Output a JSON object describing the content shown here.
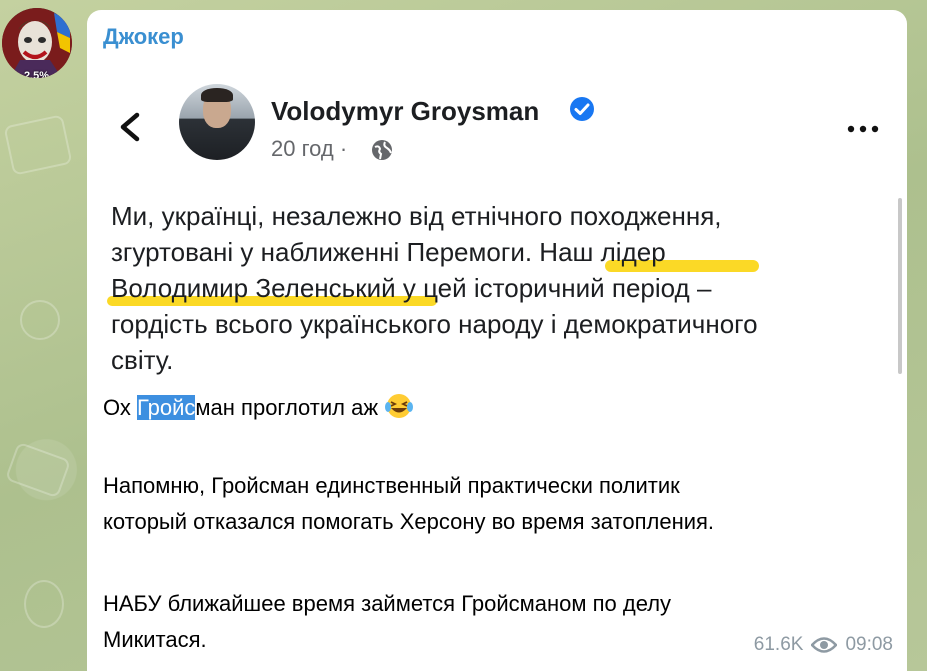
{
  "channel": {
    "avatar_badge": "2.5%",
    "sender_name": "Джокер"
  },
  "screenshot": {
    "author_name": "Volodymyr Groysman",
    "post_age": "20 год",
    "meta_separator": "·",
    "text_line1": "Ми, українці, незалежно від етнічного походження,",
    "text_line2": "згуртовані у наближенні Перемоги. Наш лідер",
    "text_line3": "Володимир Зеленський у цей історичний період –",
    "text_line4": "гордість всього українського народу і демократичного",
    "text_line5": "світу.",
    "highlight_color": "#fad200"
  },
  "message": {
    "line1_prefix": "Ох ",
    "line1_selected": "Гройс",
    "line1_suffix": "ман проглотил аж",
    "para2_line1": "Напомню, Гройсман единственный практически политик",
    "para2_line2": "который отказался помогать Херсону во время затопления.",
    "para3_line1": "НАБУ ближайшее время займется Гройсманом по делу",
    "para3_line2": "Микитася."
  },
  "footer": {
    "views": "61.6K",
    "time": "09:08"
  },
  "icons": [
    "back-icon",
    "verified-icon",
    "globe-icon",
    "more-icon",
    "laughing-emoji-icon",
    "eye-icon"
  ],
  "colors": {
    "accent": "#3a8fd1",
    "selection": "#3d8fe0",
    "wallpaper": "#b9c99a"
  }
}
